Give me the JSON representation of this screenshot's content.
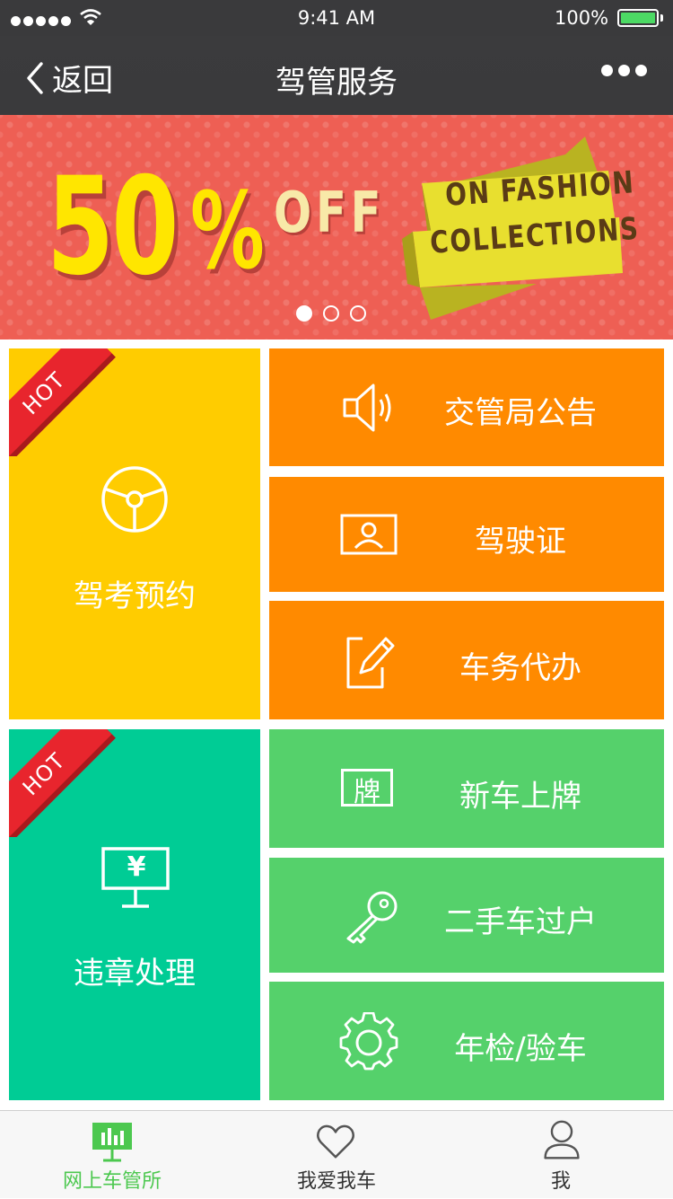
{
  "status_bar": {
    "time": "9:41 AM",
    "battery": "100%",
    "signal_icon": "signal-dots-icon",
    "wifi_icon": "wifi-icon"
  },
  "nav": {
    "back_label": "返回",
    "title": "驾管服务",
    "more_icon": "more-icon"
  },
  "banner": {
    "big_number": "50",
    "percent_sign": "%",
    "off_text": "OFF",
    "ribbon_line1": "ON FASHION",
    "ribbon_line2": "COLLECTIONS",
    "pages": 3,
    "active_page": 1,
    "background_color": "#ee5f54"
  },
  "tiles": {
    "exam": {
      "label": "驾考预约",
      "badge": "HOT",
      "icon": "steering-wheel-icon",
      "color": "#ffcc00"
    },
    "announcement": {
      "label": "交管局公告",
      "icon": "speaker-icon",
      "color": "#ff8a00"
    },
    "license": {
      "label": "驾驶证",
      "icon": "id-card-icon",
      "color": "#ff8a00"
    },
    "agency": {
      "label": "车务代办",
      "icon": "edit-icon",
      "color": "#ff8a00"
    },
    "violation": {
      "label": "违章处理",
      "badge": "HOT",
      "icon": "monitor-yen-icon",
      "yen": "¥",
      "color": "#00cc95"
    },
    "new_plate": {
      "label": "新车上牌",
      "icon": "plate-icon",
      "plate_char": "牌",
      "color": "#55d16b"
    },
    "transfer": {
      "label": "二手车过户",
      "icon": "key-icon",
      "color": "#55d16b"
    },
    "inspection": {
      "label": "年检/验车",
      "icon": "gear-icon",
      "color": "#55d16b"
    }
  },
  "tab_bar": {
    "items": [
      {
        "label": "网上车管所",
        "icon": "dashboard-chart-icon",
        "active": true
      },
      {
        "label": "我爱我车",
        "icon": "heart-icon",
        "active": false
      },
      {
        "label": "我",
        "icon": "user-icon",
        "active": false
      }
    ],
    "active_color": "#4cc84f"
  }
}
